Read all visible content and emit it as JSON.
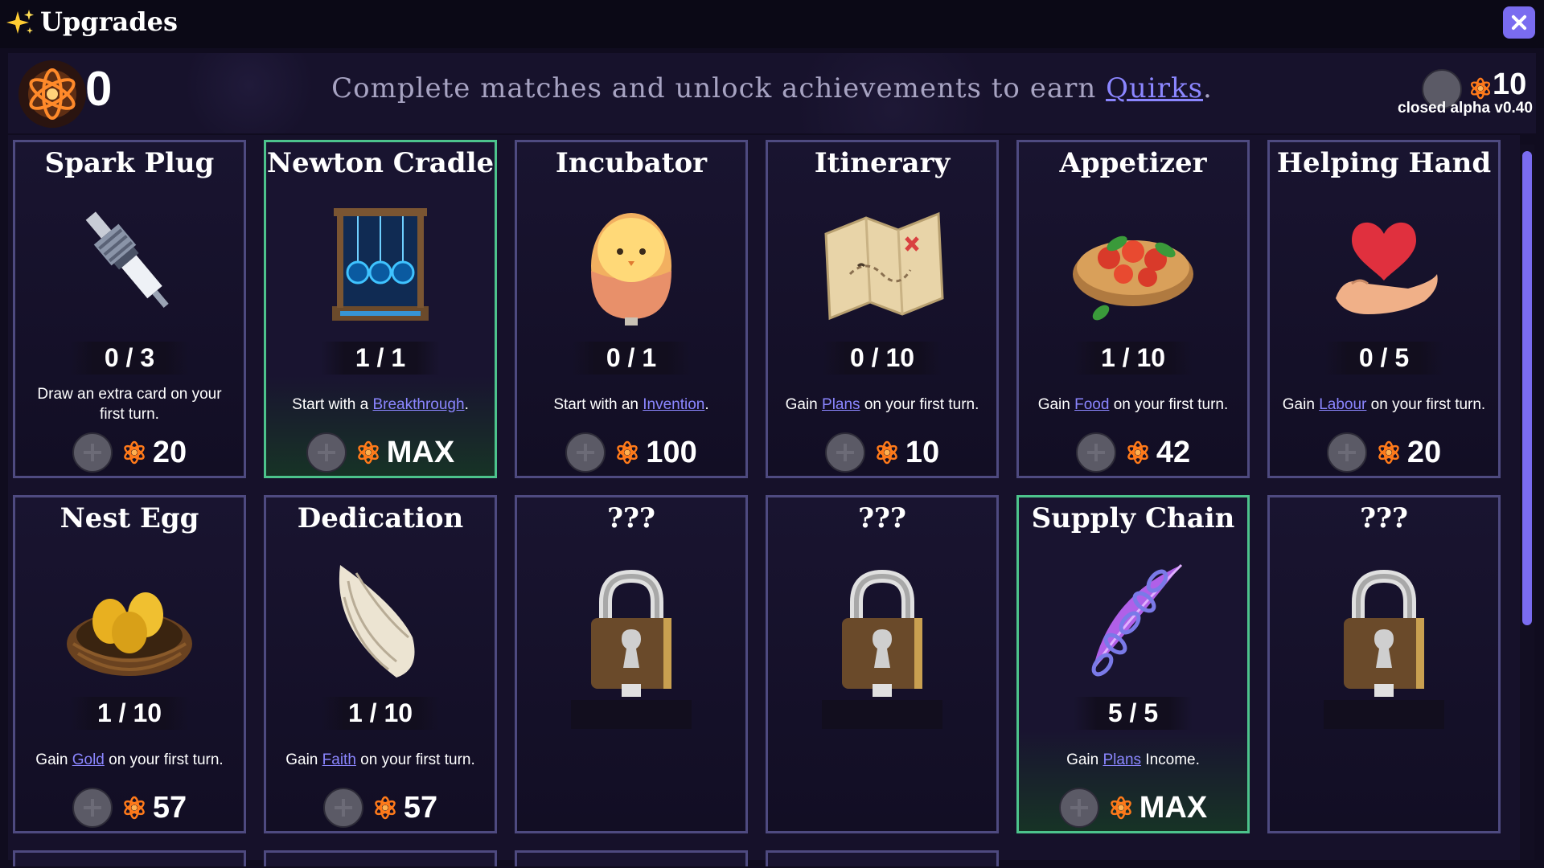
{
  "window": {
    "title": "Upgrades",
    "title_icon": "sparkles-icon"
  },
  "header": {
    "balance": "0",
    "message_before": "Complete matches and unlock achievements to earn ",
    "message_link": "Quirks",
    "message_after": ".",
    "secondary_count": "10",
    "version": "closed alpha v0.40"
  },
  "colors": {
    "accent": "#7a6cf0",
    "link": "#8b86ff",
    "max_border": "#4cc38c",
    "card_border": "#4e4a80",
    "quirk": "#ff7a1a"
  },
  "cards": [
    {
      "name": "Spark Plug",
      "icon": "spark-plug-icon",
      "level": "0 / 3",
      "desc": [
        {
          "t": "Draw an extra card on your first turn."
        }
      ],
      "cost": "20",
      "max": false
    },
    {
      "name": "Newton Cradle",
      "icon": "newton-cradle-icon",
      "level": "1 / 1",
      "desc": [
        {
          "t": "Start with a "
        },
        {
          "t": "Breakthrough",
          "kw": true
        },
        {
          "t": "."
        }
      ],
      "cost": "MAX",
      "max": true
    },
    {
      "name": "Incubator",
      "icon": "egg-icon",
      "level": "0 / 1",
      "desc": [
        {
          "t": "Start with an "
        },
        {
          "t": "Invention",
          "kw": true
        },
        {
          "t": "."
        }
      ],
      "cost": "100",
      "max": false
    },
    {
      "name": "Itinerary",
      "icon": "map-icon",
      "level": "0 / 10",
      "desc": [
        {
          "t": "Gain "
        },
        {
          "t": "Plans",
          "kw": true
        },
        {
          "t": " on your first turn."
        }
      ],
      "cost": "10",
      "max": false
    },
    {
      "name": "Appetizer",
      "icon": "bruschetta-icon",
      "level": "1 / 10",
      "desc": [
        {
          "t": "Gain "
        },
        {
          "t": "Food",
          "kw": true
        },
        {
          "t": " on your first turn."
        }
      ],
      "cost": "42",
      "max": false
    },
    {
      "name": "Helping Hand",
      "icon": "heart-hand-icon",
      "level": "0 / 5",
      "desc": [
        {
          "t": "Gain "
        },
        {
          "t": "Labour",
          "kw": true
        },
        {
          "t": " on your first turn."
        }
      ],
      "cost": "20",
      "max": false
    },
    {
      "name": "Nest Egg",
      "icon": "nest-egg-icon",
      "level": "1 / 10",
      "desc": [
        {
          "t": "Gain "
        },
        {
          "t": "Gold",
          "kw": true
        },
        {
          "t": " on your first turn."
        }
      ],
      "cost": "57",
      "max": false
    },
    {
      "name": "Dedication",
      "icon": "wing-icon",
      "level": "1 / 10",
      "desc": [
        {
          "t": "Gain "
        },
        {
          "t": "Faith",
          "kw": true
        },
        {
          "t": " on your first turn."
        }
      ],
      "cost": "57",
      "max": false
    },
    {
      "name": "???",
      "icon": "padlock-icon",
      "locked": true
    },
    {
      "name": "???",
      "icon": "padlock-icon",
      "locked": true
    },
    {
      "name": "Supply Chain",
      "icon": "chain-feather-icon",
      "level": "5 / 5",
      "desc": [
        {
          "t": "Gain "
        },
        {
          "t": "Plans",
          "kw": true
        },
        {
          "t": " Income."
        }
      ],
      "cost": "MAX",
      "max": true
    },
    {
      "name": "???",
      "icon": "padlock-icon",
      "locked": true
    }
  ]
}
